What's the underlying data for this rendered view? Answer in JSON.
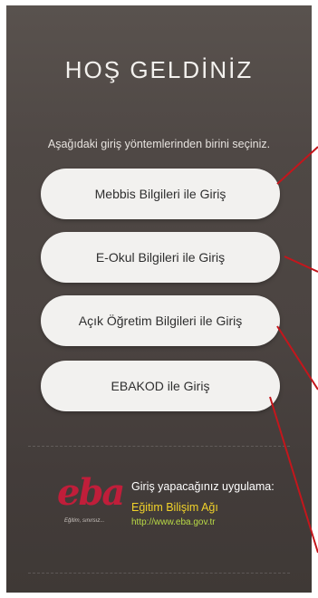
{
  "title": "HOŞ GELDİNİZ",
  "subtitle": "Aşağıdaki giriş yöntemlerinden birini seçiniz.",
  "buttons": [
    {
      "label": "Mebbis Bilgileri ile Giriş"
    },
    {
      "label": "E-Okul Bilgileri ile Giriş"
    },
    {
      "label": "Açık Öğretim Bilgileri ile Giriş"
    },
    {
      "label": "EBAKOD ile Giriş"
    }
  ],
  "footer": {
    "logo_text": "eba",
    "logo_tagline": "Eğitim, sınırsız...",
    "app_label": "Giriş yapacağınız uygulama:",
    "app_name": "Eğitim Bilişim Ağı",
    "app_url": "http://www.eba.gov.tr"
  },
  "colors": {
    "annotation_line": "#c4161c",
    "logo": "#c01e3a",
    "app_name": "#f1d229",
    "app_url": "#b9da46"
  }
}
